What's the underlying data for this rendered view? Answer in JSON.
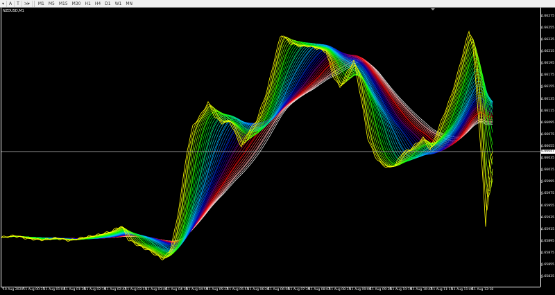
{
  "toolbar": {
    "tools": [
      "A",
      "T"
    ],
    "timeframes": [
      "M1",
      "M5",
      "M15",
      "M30",
      "H1",
      "H4",
      "D1",
      "W1",
      "MN"
    ]
  },
  "chart": {
    "title": "NZDUSD,M1",
    "current_price": "0.66047"
  },
  "chart_data": {
    "type": "line",
    "price_ticks": [
      "0.66275",
      "0.66255",
      "0.66235",
      "0.66215",
      "0.66195",
      "0.66175",
      "0.66155",
      "0.66135",
      "0.66115",
      "0.66095",
      "0.66075",
      "0.66055",
      "0.66035",
      "0.66015",
      "0.65995",
      "0.65975",
      "0.65955",
      "0.65935",
      "0.65915",
      "0.65895",
      "0.65875",
      "0.65855",
      "0.65835"
    ],
    "time_ticks": [
      "10 Aug 2020",
      "11 Aug 00:31",
      "11 Aug 01:04",
      "11 Aug 01:38",
      "11 Aug 02:10",
      "11 Aug 02:42",
      "11 Aug 03:14",
      "11 Aug 03:46",
      "11 Aug 04:18",
      "11 Aug 04:50",
      "11 Aug 05:22",
      "11 Aug 05:54",
      "11 Aug 06:26",
      "11 Aug 06:58",
      "11 Aug 07:30",
      "11 Aug 08:02",
      "11 Aug 08:34",
      "11 Aug 09:06",
      "11 Aug 09:38",
      "11 Aug 10:10",
      "11 Aug 10:42",
      "11 Aug 11:14",
      "11 Aug 11:46",
      "11 Aug 12:18"
    ],
    "ylim": [
      0.65826,
      0.66284
    ],
    "price_path": [
      [
        0,
        0.65902
      ],
      [
        20,
        0.65905
      ],
      [
        40,
        0.659
      ],
      [
        60,
        0.65898
      ],
      [
        80,
        0.65901
      ],
      [
        100,
        0.65897
      ],
      [
        120,
        0.65902
      ],
      [
        140,
        0.65906
      ],
      [
        160,
        0.65912
      ],
      [
        175,
        0.65922
      ],
      [
        185,
        0.65898
      ],
      [
        200,
        0.65888
      ],
      [
        215,
        0.6588
      ],
      [
        225,
        0.65872
      ],
      [
        235,
        0.65865
      ],
      [
        245,
        0.6588
      ],
      [
        255,
        0.6593
      ],
      [
        262,
        0.65985
      ],
      [
        270,
        0.6605
      ],
      [
        278,
        0.6609
      ],
      [
        290,
        0.6611
      ],
      [
        300,
        0.6613
      ],
      [
        310,
        0.66105
      ],
      [
        320,
        0.66095
      ],
      [
        330,
        0.661
      ],
      [
        340,
        0.66075
      ],
      [
        348,
        0.66055
      ],
      [
        355,
        0.66075
      ],
      [
        370,
        0.661
      ],
      [
        385,
        0.6615
      ],
      [
        395,
        0.662
      ],
      [
        405,
        0.66245
      ],
      [
        418,
        0.6623
      ],
      [
        430,
        0.66225
      ],
      [
        445,
        0.66225
      ],
      [
        460,
        0.6622
      ],
      [
        470,
        0.66215
      ],
      [
        480,
        0.66175
      ],
      [
        490,
        0.66155
      ],
      [
        500,
        0.6618
      ],
      [
        510,
        0.662
      ],
      [
        520,
        0.6614
      ],
      [
        530,
        0.6607
      ],
      [
        540,
        0.6604
      ],
      [
        550,
        0.66025
      ],
      [
        560,
        0.6602
      ],
      [
        570,
        0.66025
      ],
      [
        580,
        0.66045
      ],
      [
        590,
        0.6605
      ],
      [
        600,
        0.6606
      ],
      [
        610,
        0.6607
      ],
      [
        620,
        0.6605
      ],
      [
        630,
        0.6608
      ],
      [
        640,
        0.6611
      ],
      [
        650,
        0.6614
      ],
      [
        660,
        0.6618
      ],
      [
        670,
        0.66225
      ],
      [
        676,
        0.6625
      ],
      [
        682,
        0.6622
      ],
      [
        690,
        0.661
      ],
      [
        695,
        0.6602
      ],
      [
        700,
        0.6592
      ],
      [
        705,
        0.6603
      ],
      [
        710,
        0.66045
      ]
    ],
    "ribbon_colors": [
      "#ffff00",
      "#00ff00",
      "#00bfff",
      "#0000cd",
      "#ff0000",
      "#ffffff"
    ],
    "grid": false,
    "legend": "none"
  }
}
